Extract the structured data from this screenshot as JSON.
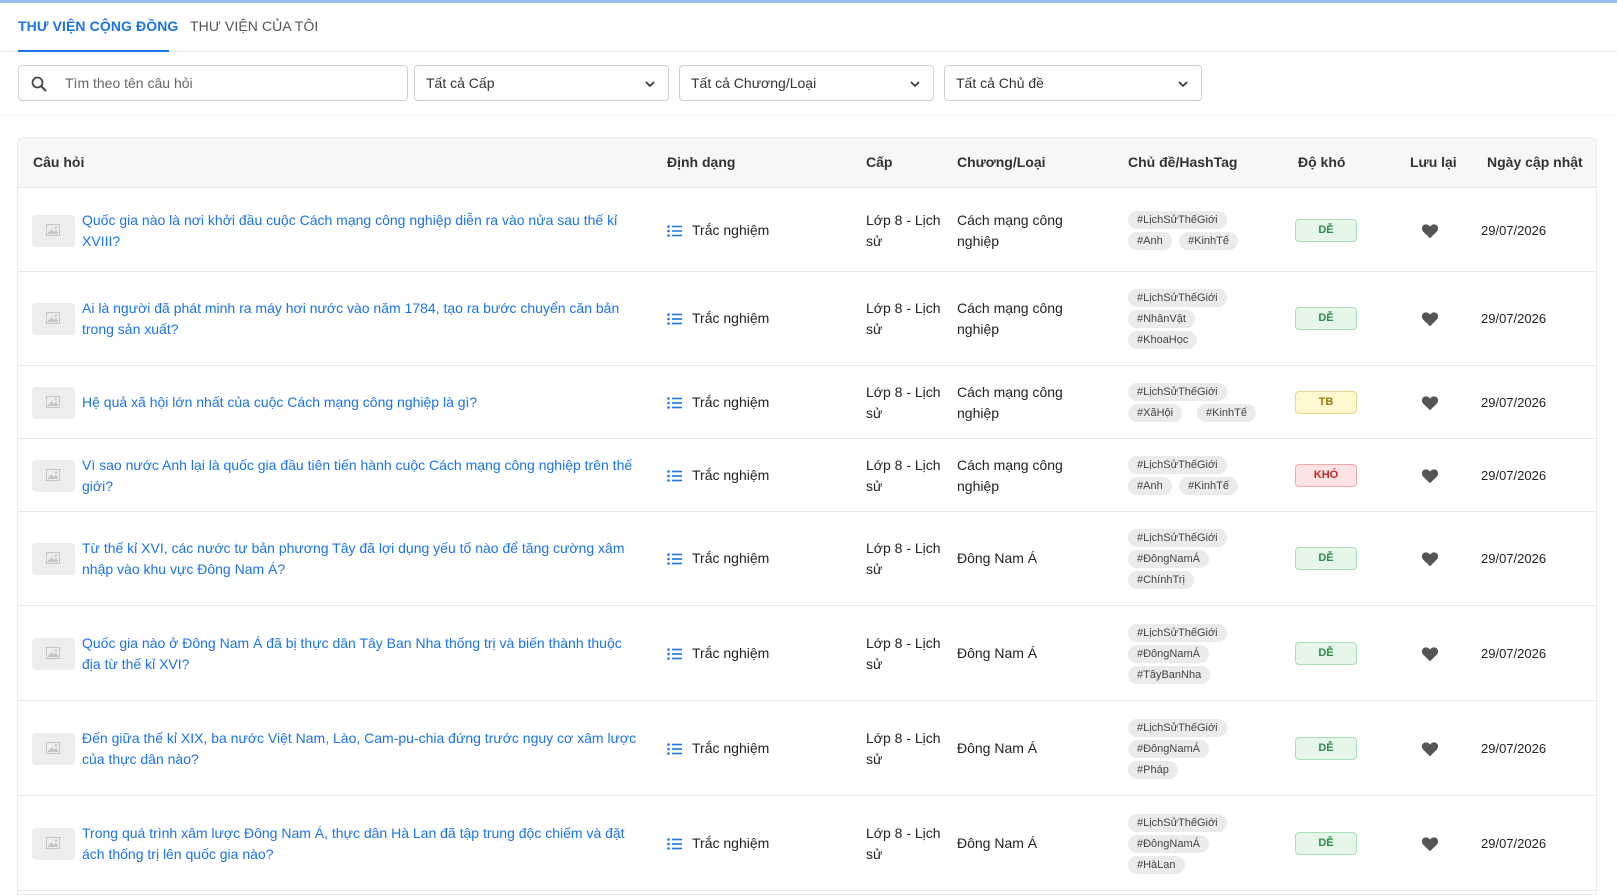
{
  "tabs": [
    {
      "label": "THƯ VIỆN CỘNG ĐỒNG",
      "active": true
    },
    {
      "label": "THƯ VIỆN CỦA TÔI",
      "active": false
    }
  ],
  "filters": {
    "search_placeholder": "Tìm theo tên câu hỏi",
    "level": "Tất cả Cấp",
    "chapter": "Tất cả Chương/Loại",
    "topic": "Tất cả Chủ đề"
  },
  "columns": [
    "Câu hỏi",
    "Định dạng",
    "Cấp",
    "Chương/Loại",
    "Chủ đề/HashTag",
    "Độ khó",
    "Lưu lại",
    "Ngày cập nhật"
  ],
  "colors": {
    "accent": "#1a73e8",
    "heart": "#555555",
    "easy": "#2e8b46",
    "medium": "#9a7a0a",
    "hard": "#c62828"
  },
  "rows": [
    {
      "question": "Quốc gia nào là nơi khởi đầu cuộc Cách mạng công nghiệp diễn ra vào nửa sau thế kỉ XVIII?",
      "format": "Trắc nghiệm",
      "level": "Lớp 8 - Lịch sử",
      "chapter": "Cách mạng công nghiệp",
      "tags": [
        "#LịchSửThếGiới",
        "#Anh",
        "#KinhTế"
      ],
      "difficulty": "DỄ",
      "difficulty_kind": "easy",
      "date": "29/07/2026"
    },
    {
      "question": "Ai là người đã phát minh ra máy hơi nước vào năm 1784, tạo ra bước chuyển căn bản trong sản xuất?",
      "format": "Trắc nghiệm",
      "level": "Lớp 8 - Lịch sử",
      "chapter": "Cách mạng công nghiệp",
      "tags": [
        "#LịchSửThếGiới",
        "#NhânVật",
        "#KhoaHọc"
      ],
      "difficulty": "DỄ",
      "difficulty_kind": "easy",
      "date": "29/07/2026"
    },
    {
      "question": "Hệ quả xã hội lớn nhất của cuộc Cách mạng công nghiệp là gì?",
      "format": "Trắc nghiệm",
      "level": "Lớp 8 - Lịch sử",
      "chapter": "Cách mạng công nghiệp",
      "tags": [
        "#LịchSửThếGiới",
        "#XãHội",
        "#KinhTế"
      ],
      "difficulty": "TB",
      "difficulty_kind": "mid",
      "date": "29/07/2026"
    },
    {
      "question": "Vì sao nước Anh lại là quốc gia đầu tiên tiến hành cuộc Cách mạng công nghiệp trên thế giới?",
      "format": "Trắc nghiệm",
      "level": "Lớp 8 - Lịch sử",
      "chapter": "Cách mạng công nghiệp",
      "tags": [
        "#LịchSửThếGiới",
        "#Anh",
        "#KinhTế"
      ],
      "difficulty": "KHÓ",
      "difficulty_kind": "hard",
      "date": "29/07/2026"
    },
    {
      "question": "Từ thế kỉ XVI, các nước tư bản phương Tây đã lợi dụng yếu tố nào để tăng cường xâm nhập vào khu vực Đông Nam Á?",
      "format": "Trắc nghiệm",
      "level": "Lớp 8 - Lịch sử",
      "chapter": "Đông Nam Á",
      "tags": [
        "#LịchSửThếGiới",
        "#ĐôngNamÁ",
        "#ChínhTrị"
      ],
      "difficulty": "DỄ",
      "difficulty_kind": "easy",
      "date": "29/07/2026"
    },
    {
      "question": "Quốc gia nào ở Đông Nam Á đã bị thực dân Tây Ban Nha thống trị và biến thành thuộc địa từ thế kỉ XVI?",
      "format": "Trắc nghiệm",
      "level": "Lớp 8 - Lịch sử",
      "chapter": "Đông Nam Á",
      "tags": [
        "#LịchSửThếGiới",
        "#ĐôngNamÁ",
        "#TâyBanNha"
      ],
      "difficulty": "DỄ",
      "difficulty_kind": "easy",
      "date": "29/07/2026"
    },
    {
      "question": "Đến giữa thế kỉ XIX, ba nước Việt Nam, Lào, Cam-pu-chia đứng trước nguy cơ xâm lược của thực dân nào?",
      "format": "Trắc nghiệm",
      "level": "Lớp 8 - Lịch sử",
      "chapter": "Đông Nam Á",
      "tags": [
        "#LịchSửThếGiới",
        "#ĐôngNamÁ",
        "#Pháp"
      ],
      "difficulty": "DỄ",
      "difficulty_kind": "easy",
      "date": "29/07/2026"
    },
    {
      "question": "Trong quá trình xâm lược Đông Nam Á, thực dân Hà Lan đã tập trung độc chiếm và đặt ách thống trị lên quốc gia nào?",
      "format": "Trắc nghiệm",
      "level": "Lớp 8 - Lịch sử",
      "chapter": "Đông Nam Á",
      "tags": [
        "#LịchSửThếGiới",
        "#ĐôngNamÁ",
        "#HàLan"
      ],
      "difficulty": "DỄ",
      "difficulty_kind": "easy",
      "date": "29/07/2026"
    }
  ]
}
